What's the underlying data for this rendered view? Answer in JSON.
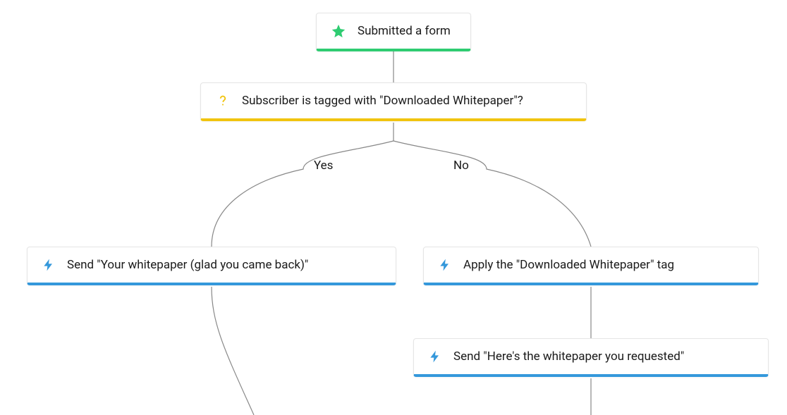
{
  "colors": {
    "trigger": "#2ecc71",
    "condition": "#f1c40f",
    "action": "#3498db"
  },
  "trigger": {
    "label": "Submitted a form"
  },
  "condition": {
    "label": "Subscriber is tagged with \"Downloaded Whitepaper\"?"
  },
  "branches": {
    "yes_label": "Yes",
    "no_label": "No"
  },
  "actions": {
    "yes_send": {
      "label": "Send \"Your whitepaper (glad you came back)\""
    },
    "no_apply": {
      "label": "Apply the \"Downloaded Whitepaper\" tag"
    },
    "no_send": {
      "label": "Send \"Here's the whitepaper you requested\""
    }
  }
}
